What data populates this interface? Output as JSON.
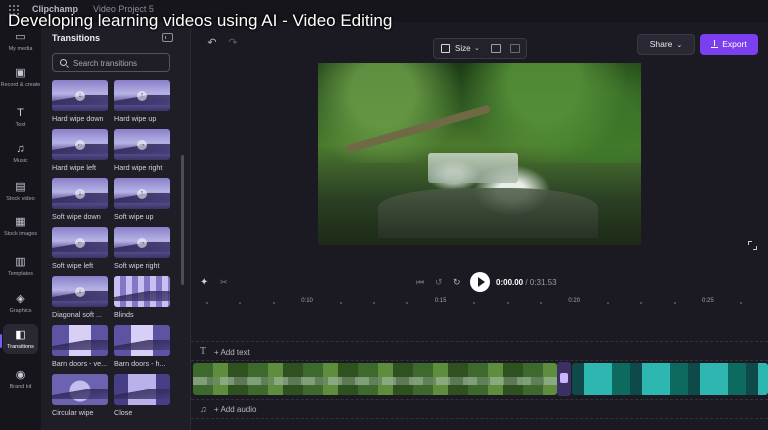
{
  "overlay_title": "Developing learning videos using AI - Video Editing",
  "appbar": {
    "brand": "Clipchamp",
    "project": "Video Project 5"
  },
  "rail": [
    {
      "label": "My media",
      "icon": "folder-icon"
    },
    {
      "label": "Record & create",
      "icon": "camera-icon"
    },
    {
      "label": "Text",
      "icon": "text-icon"
    },
    {
      "label": "Music",
      "icon": "music-note-icon"
    },
    {
      "label": "Stock video",
      "icon": "film-icon"
    },
    {
      "label": "Stock images",
      "icon": "image-icon"
    },
    {
      "label": "Templates",
      "icon": "templates-icon"
    },
    {
      "label": "Graphics",
      "icon": "shapes-icon"
    },
    {
      "label": "Transitions",
      "icon": "transitions-icon",
      "active": true
    },
    {
      "label": "Brand kit",
      "icon": "brand-kit-icon"
    }
  ],
  "panel": {
    "title": "Transitions",
    "search_placeholder": "Search transitions",
    "items": [
      {
        "label": "Hard wipe down",
        "style": "dir",
        "glyph": "↓"
      },
      {
        "label": "Hard wipe up",
        "style": "dir",
        "glyph": "↑"
      },
      {
        "label": "Hard wipe left",
        "style": "dir",
        "glyph": "←"
      },
      {
        "label": "Hard wipe right",
        "style": "dir",
        "glyph": "→"
      },
      {
        "label": "Soft wipe down",
        "style": "dir",
        "glyph": "↓"
      },
      {
        "label": "Soft wipe up",
        "style": "dir",
        "glyph": "↑"
      },
      {
        "label": "Soft wipe left",
        "style": "dir",
        "glyph": "←"
      },
      {
        "label": "Soft wipe right",
        "style": "dir",
        "glyph": "→"
      },
      {
        "label": "Diagonal soft ...",
        "style": "dir",
        "glyph": "↓"
      },
      {
        "label": "Blinds",
        "style": "blinds",
        "glyph": ""
      },
      {
        "label": "Barn doors - ve...",
        "style": "barn",
        "glyph": ""
      },
      {
        "label": "Barn doors - h...",
        "style": "barn",
        "glyph": ""
      },
      {
        "label": "Circular wipe",
        "style": "circle",
        "glyph": ""
      },
      {
        "label": "Close",
        "style": "close",
        "glyph": ""
      }
    ]
  },
  "toolbar": {
    "size_label": "Size",
    "share_label": "Share",
    "export_label": "Export"
  },
  "playback": {
    "current": "0:00.00",
    "total": "/ 0:31.53"
  },
  "ruler_labels": [
    "0:10",
    "0:15",
    "0:20",
    "0:25"
  ],
  "timeline": {
    "add_text": "+ Add text",
    "add_audio": "+ Add audio"
  },
  "colors": {
    "accent": "#7b3ff0",
    "panel_bg": "#1f1e27",
    "app_bg": "#1b1a22"
  }
}
